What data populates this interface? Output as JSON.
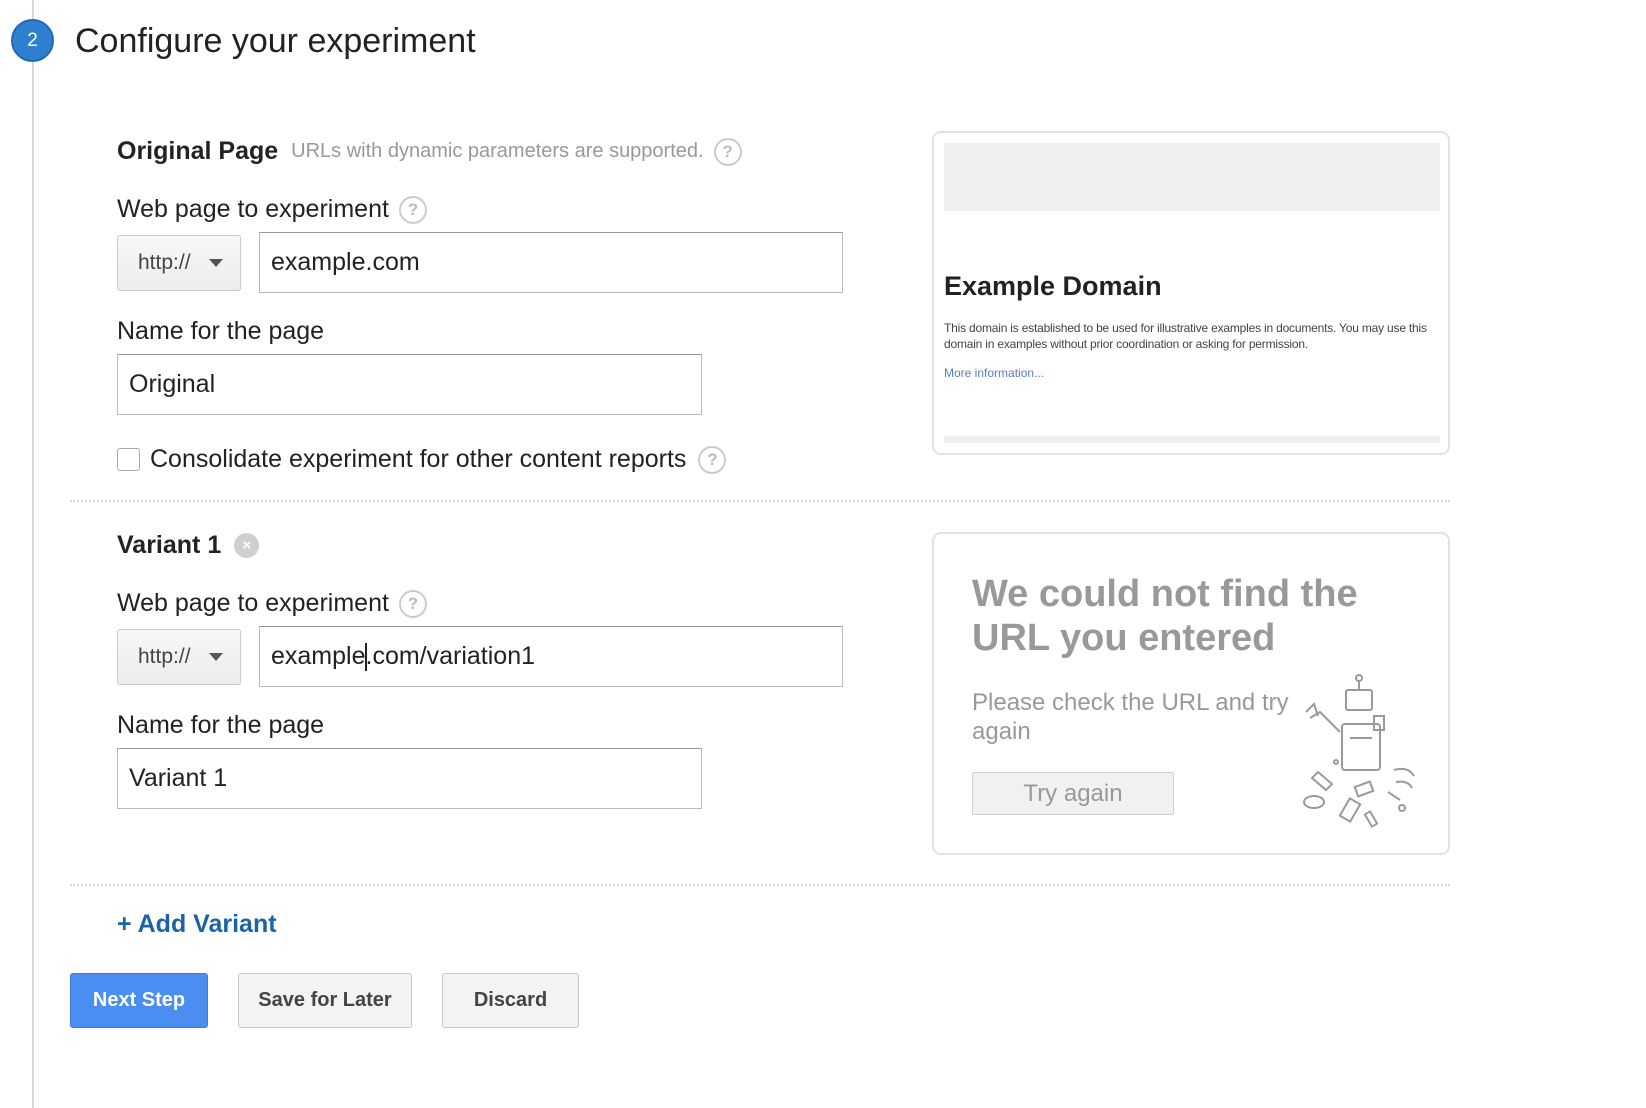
{
  "step": {
    "number": "2",
    "title": "Configure your experiment"
  },
  "original": {
    "title": "Original Page",
    "hint": "URLs with dynamic parameters are supported.",
    "url_label": "Web page to experiment",
    "protocol": "http://",
    "url": "example.com",
    "name_label": "Name for the page",
    "name": "Original",
    "consolidate_label": "Consolidate experiment for other content reports",
    "consolidate_checked": false
  },
  "original_preview": {
    "heading": "Example Domain",
    "text": "This domain is established to be used for illustrative examples in documents. You may use this domain in examples without prior coordination or asking for permission.",
    "link": "More information..."
  },
  "variant": {
    "title": "Variant 1",
    "url_label": "Web page to experiment",
    "protocol": "http://",
    "url_before_cursor": "example",
    "url_after_cursor": ".com/variation1",
    "name_label": "Name for the page",
    "name": "Variant 1"
  },
  "variant_error": {
    "title": "We could not find the URL you entered",
    "subtitle": "Please check the URL and try again",
    "try_again": "Try again"
  },
  "add_variant": "+ Add Variant",
  "actions": {
    "next": "Next Step",
    "save": "Save for Later",
    "discard": "Discard"
  },
  "icons": {
    "help": "?",
    "remove": "×"
  }
}
